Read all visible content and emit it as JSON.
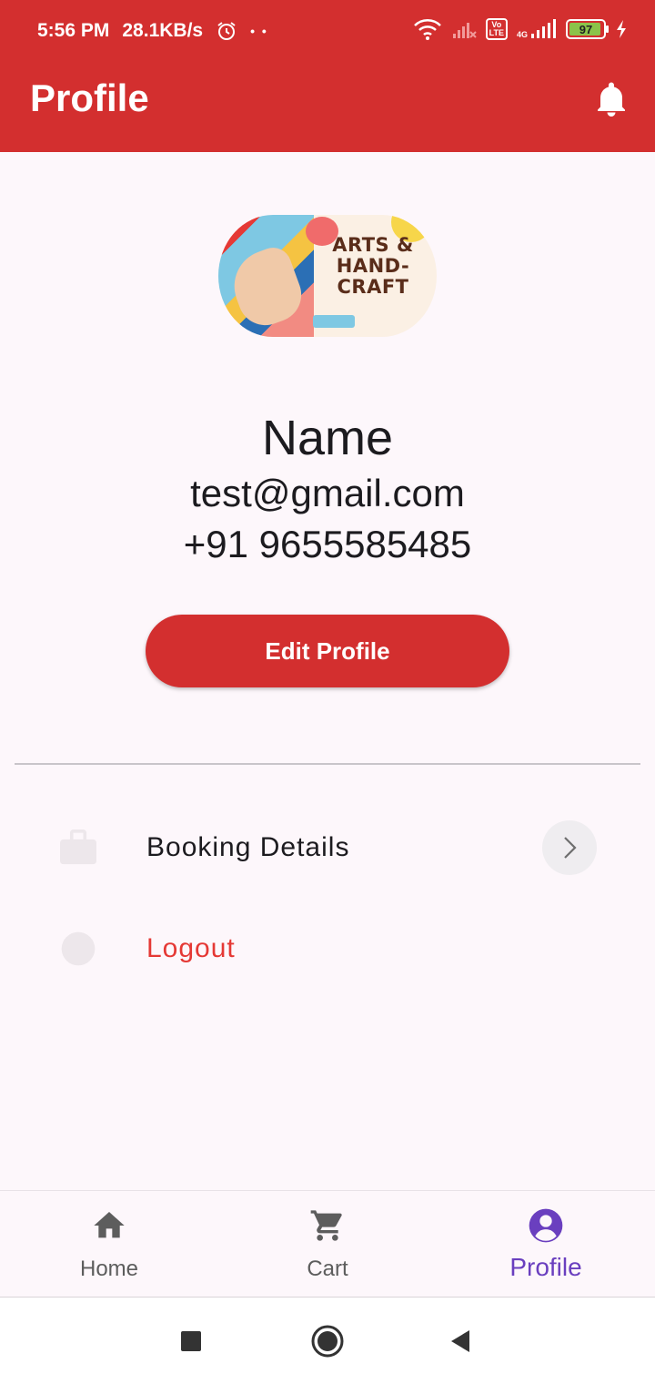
{
  "status_bar": {
    "time": "5:56 PM",
    "speed": "28.1KB/s",
    "network": "4G",
    "volte": "Vo LTE",
    "battery": "97"
  },
  "header": {
    "title": "Profile"
  },
  "banner": {
    "line1": "ARTS &",
    "line2": "HAND-",
    "line3": "CRAFT"
  },
  "profile": {
    "name": "Name",
    "email": "test@gmail.com",
    "phone": "+91 9655585485",
    "edit_label": "Edit Profile"
  },
  "menu": [
    {
      "label": "Booking Details",
      "icon": "briefcase-icon"
    },
    {
      "label": "Logout",
      "icon": "logout-icon"
    }
  ],
  "bottom_nav": [
    {
      "label": "Home",
      "icon": "home-icon"
    },
    {
      "label": "Cart",
      "icon": "cart-icon"
    },
    {
      "label": "Profile",
      "icon": "account-circle-icon",
      "active": true
    }
  ],
  "colors": {
    "primary": "#d32f2f",
    "logout": "#e53935",
    "nav_active": "#6a3fbf"
  }
}
